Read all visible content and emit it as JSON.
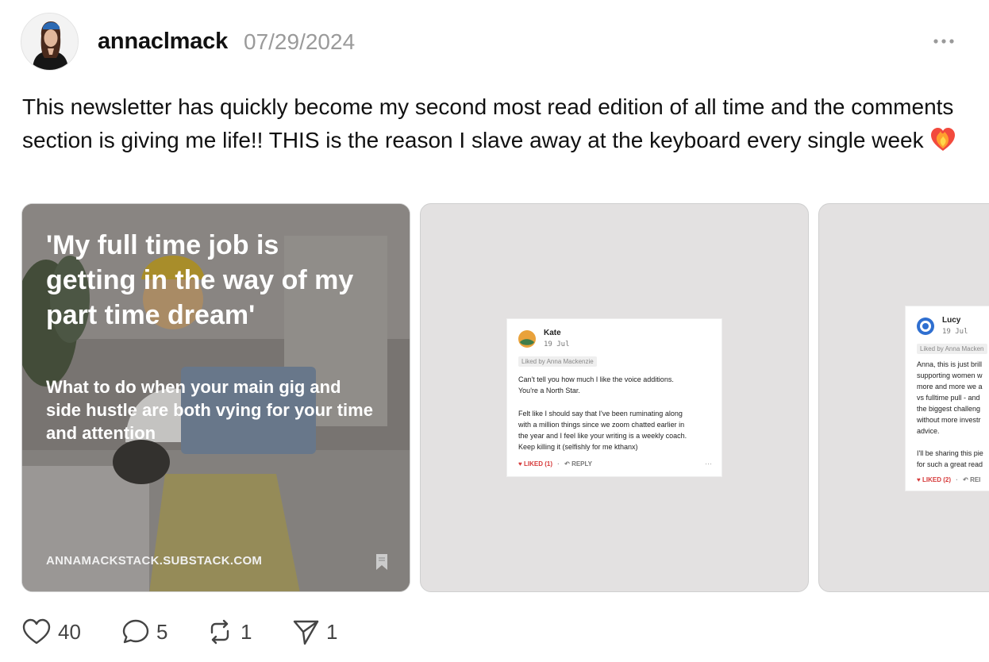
{
  "post": {
    "username": "annaclmack",
    "date": "07/29/2024",
    "text": "This newsletter has quickly become my second most read edition of all time and the comments section is giving me life!! THIS is the reason I slave away at the keyboard every single week"
  },
  "cards": [
    {
      "headline": "'My full time job is getting in the way of my part time dream'",
      "subtitle": "What to do when your main gig and side hustle are both vying for your time and attention",
      "domain": "ANNAMACKSTACK.SUBSTACK.COM"
    },
    {
      "comment": {
        "name": "Kate",
        "date": "19 Jul",
        "liked_by": "Liked by Anna Mackenzie",
        "para1_lines": [
          "Can't tell you how much I like the voice additions.",
          "You're a North Star."
        ],
        "para2_lines": [
          "Felt like I should say that I've been ruminating along",
          "with a million things since we zoom chatted earlier in",
          "the year and I feel like your writing is a weekly coach.",
          "Keep killing it (selfishly for me kthanx)"
        ],
        "liked": "LIKED (1)",
        "reply": "REPLY",
        "more": "···"
      }
    },
    {
      "comment": {
        "name": "Lucy",
        "date": "19 Jul",
        "liked_by": "Liked by Anna Macken",
        "para1_lines": [
          "Anna, this is just brill",
          "supporting women w",
          "more and more we a",
          "vs fulltime pull - and",
          "the biggest challeng",
          "without more investr",
          "advice."
        ],
        "para2_lines": [
          "I'll be sharing this pie",
          "for such a great read"
        ],
        "liked": "LIKED (2)",
        "reply": "REI"
      }
    }
  ],
  "actions": {
    "likes": "40",
    "comments": "5",
    "restacks": "1",
    "shares": "1"
  },
  "colors": {
    "liked": "#d63a3a",
    "muted": "#9a9a9a"
  }
}
